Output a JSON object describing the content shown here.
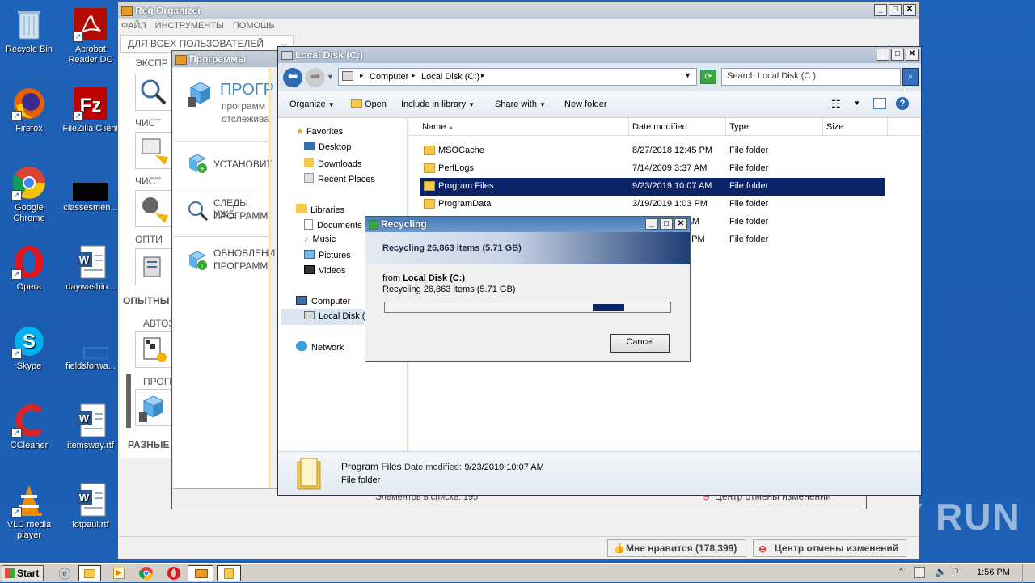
{
  "desktop_icons": [
    {
      "label": "Recycle Bin",
      "icon": "recycle-bin-icon"
    },
    {
      "label": "Acrobat Reader DC",
      "icon": "acrobat-icon"
    },
    {
      "label": "Firefox",
      "icon": "firefox-icon"
    },
    {
      "label": "FileZilla Client",
      "icon": "filezilla-icon"
    },
    {
      "label": "Google Chrome",
      "icon": "chrome-icon"
    },
    {
      "label": "classesmen...",
      "icon": "black-file-icon"
    },
    {
      "label": "Opera",
      "icon": "opera-icon"
    },
    {
      "label": "daywashin...",
      "icon": "word-doc-icon"
    },
    {
      "label": "Skype",
      "icon": "skype-icon"
    },
    {
      "label": "fieldsforwa...",
      "icon": "blank-file-icon"
    },
    {
      "label": "CCleaner",
      "icon": "ccleaner-icon"
    },
    {
      "label": "itemsway.rtf",
      "icon": "word-doc-icon"
    },
    {
      "label": "VLC media player",
      "icon": "vlc-icon"
    },
    {
      "label": "lotpaul.rtf",
      "icon": "word-doc-icon"
    }
  ],
  "regorg": {
    "title": "Reg Organizer",
    "menu": [
      "ФАЙЛ",
      "ИНСТРУМЕНТЫ",
      "ПОМОЩЬ"
    ],
    "for_all": "ДЛЯ ВСЕХ ПОЛЬЗОВАТЕЛЕЙ",
    "sections": [
      "ЭКСПР",
      "ЧИСТ",
      "ЧИСТ",
      "ОПТИ",
      "ОПЫТНЫ",
      "АВТОЗ",
      "ПРОГР",
      "РАЗНЫЕ"
    ],
    "status_like": "Мне нравится (178,399)",
    "status_undo": "Центр отмены изменений"
  },
  "programs": {
    "title": "Программы",
    "heading": "ПРОГР",
    "sub1": "программ",
    "sub2": "отслежива",
    "items": [
      {
        "line1": "УСТАНОВИТ",
        "line2": ""
      },
      {
        "line1": "СЛЕДЫ УЖЕ",
        "line2": "ПРОГРАММ"
      },
      {
        "line1": "ОБНОВЛЕНИ",
        "line2": "ПРОГРАММ"
      }
    ],
    "status_count": "Элементов в списке: 195",
    "status_undo": "Центр отмены изменений"
  },
  "explorer": {
    "title": "Local Disk (C:)",
    "breadcrumb": [
      "Computer",
      "Local Disk (C:)"
    ],
    "search_placeholder": "Search Local Disk (C:)",
    "toolbar": [
      "Organize",
      "Open",
      "Include in library",
      "Share with",
      "New folder"
    ],
    "nav": {
      "favorites": "Favorites",
      "fav_items": [
        "Desktop",
        "Downloads",
        "Recent Places"
      ],
      "libraries": "Libraries",
      "lib_items": [
        "Documents",
        "Music",
        "Pictures",
        "Videos"
      ],
      "computer": "Computer",
      "local_disk": "Local Disk (",
      "network": "Network"
    },
    "columns": [
      "Name",
      "Date modified",
      "Type",
      "Size"
    ],
    "rows": [
      {
        "name": "MSOCache",
        "date": "8/27/2018 12:45 PM",
        "type": "File folder"
      },
      {
        "name": "PerfLogs",
        "date": "7/14/2009 3:37 AM",
        "type": "File folder"
      },
      {
        "name": "Program Files",
        "date": "9/23/2019 10:07 AM",
        "type": "File folder"
      },
      {
        "name": "ProgramData",
        "date": "3/19/2019 1:03 PM",
        "type": "File folder"
      },
      {
        "name": "",
        "date": "9 AM",
        "type": "File folder"
      },
      {
        "name": "",
        "date": "5 PM",
        "type": "File folder"
      }
    ],
    "details": {
      "name": "Program Files",
      "date_label": "Date modified:",
      "date": "9/23/2019 10:07 AM",
      "type": "File folder"
    }
  },
  "recycling": {
    "title": "Recycling",
    "header": "Recycling 26,863 items (5.71 GB)",
    "from_label": "from",
    "from_target": "Local Disk (C:)",
    "detail": "Recycling 26,863 items (5.71 GB)",
    "progress": 0.15,
    "cancel": "Cancel"
  },
  "taskbar": {
    "start": "Start",
    "time": "1:56 PM"
  },
  "watermark": "ANY RUN"
}
